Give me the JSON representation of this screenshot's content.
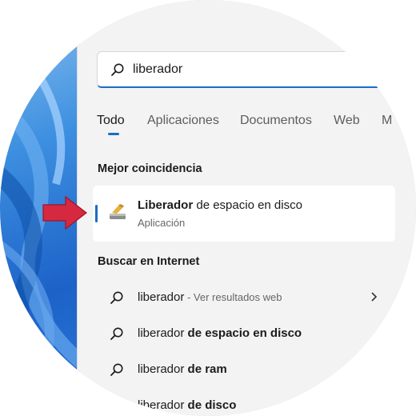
{
  "search": {
    "value": "liberador"
  },
  "tabs": [
    {
      "label": "Todo",
      "active": true
    },
    {
      "label": "Aplicaciones"
    },
    {
      "label": "Documentos"
    },
    {
      "label": "Web"
    },
    {
      "label": "M"
    }
  ],
  "best_match": {
    "heading": "Mejor coincidencia",
    "title_bold": "Liberador",
    "title_rest": " de espacio en disco",
    "subtitle": "Aplicación",
    "icon": "disk-cleanup-icon"
  },
  "internet": {
    "heading": "Buscar en Internet",
    "results": [
      {
        "prefix": "liberador",
        "bold": "",
        "hint": " - Ver resultados web",
        "chevron": true
      },
      {
        "prefix": "liberador ",
        "bold": "de espacio en disco",
        "hint": ""
      },
      {
        "prefix": "liberador ",
        "bold": "de ram",
        "hint": ""
      },
      {
        "prefix": "liberador ",
        "bold": "de disco",
        "hint": ""
      }
    ]
  },
  "colors": {
    "accent": "#1a6ec2",
    "arrow": "#d6283f",
    "panel": "#f3f3f3"
  }
}
